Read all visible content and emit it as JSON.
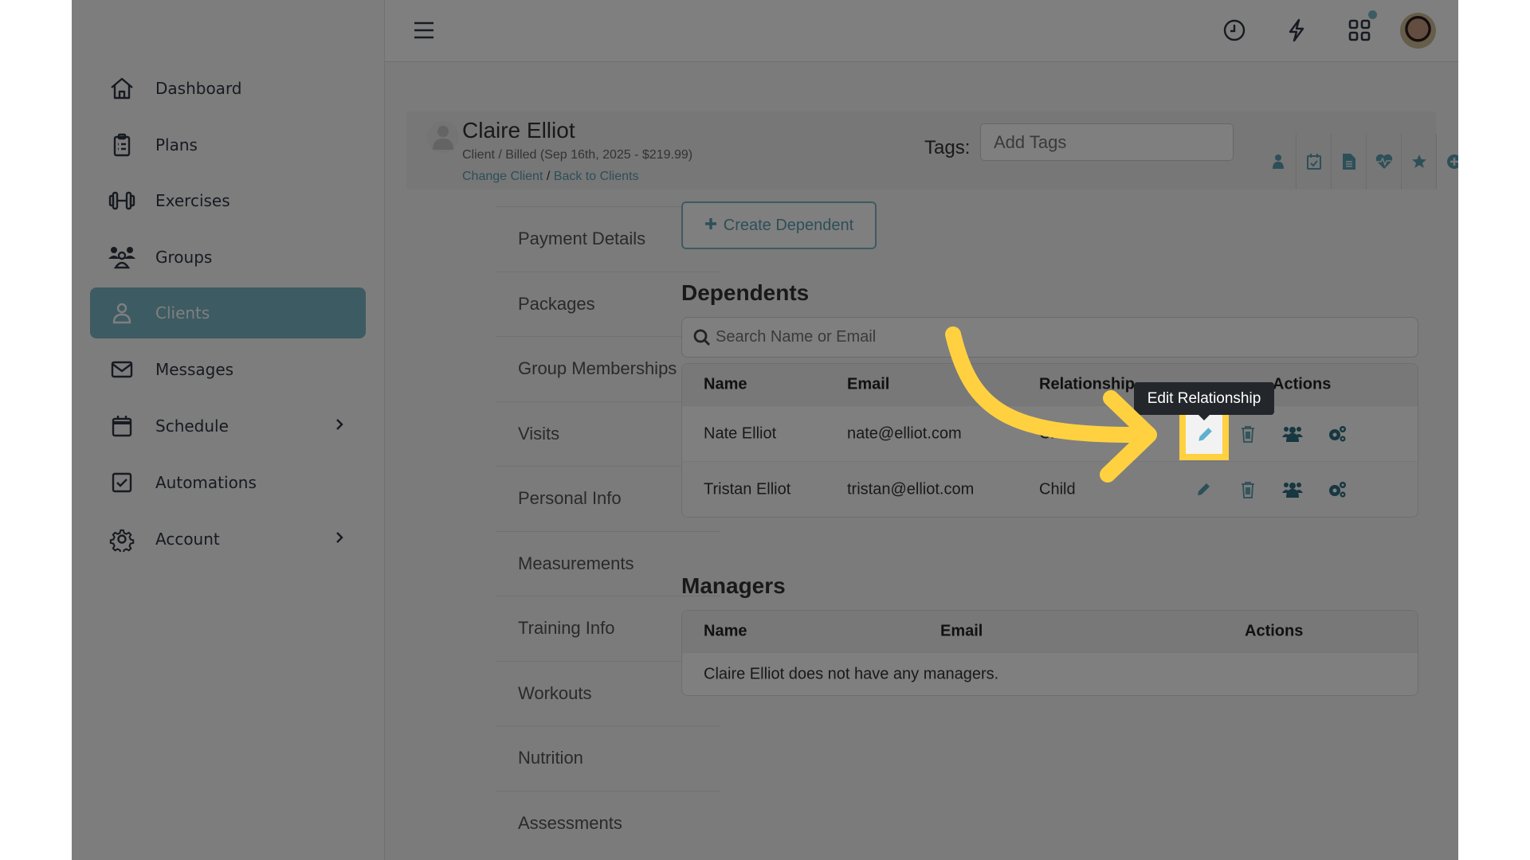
{
  "sidebar": {
    "items": [
      {
        "label": "Dashboard",
        "icon": "home-icon"
      },
      {
        "label": "Plans",
        "icon": "clipboard-icon"
      },
      {
        "label": "Exercises",
        "icon": "dumbbell-icon"
      },
      {
        "label": "Groups",
        "icon": "users-icon"
      },
      {
        "label": "Clients",
        "icon": "user-icon",
        "active": true
      },
      {
        "label": "Messages",
        "icon": "envelope-icon"
      },
      {
        "label": "Schedule",
        "icon": "calendar-icon",
        "has_submenu": true
      },
      {
        "label": "Automations",
        "icon": "checkbox-icon"
      },
      {
        "label": "Account",
        "icon": "gear-icon",
        "has_submenu": true
      }
    ]
  },
  "topbar": {
    "icons": [
      "menu-icon",
      "clock-icon",
      "lightning-icon",
      "grid-icon",
      "bell-icon",
      "avatar"
    ],
    "notification_dot": true
  },
  "client": {
    "name": "Claire Elliot",
    "subtitle": "Client / Billed (Sep 16th, 2025 - $219.99)",
    "change_client": "Change Client",
    "separator": "/",
    "back_to_clients": "Back to Clients",
    "tags_label": "Tags:",
    "tags_placeholder": "Add Tags",
    "header_icons": [
      "user-icon",
      "calendar-check-icon",
      "document-icon",
      "heartbeat-icon",
      "star-icon",
      "plus-circle-icon",
      "envelope-icon"
    ]
  },
  "subnav": {
    "items": [
      "Payment Details",
      "Packages",
      "Group Memberships",
      "Visits",
      "Personal Info",
      "Measurements",
      "Training Info",
      "Workouts",
      "Nutrition",
      "Assessments"
    ]
  },
  "dependents": {
    "create_button": "Create Dependent",
    "title": "Dependents",
    "search_placeholder": "Search Name or Email",
    "columns": [
      "Name",
      "Email",
      "Relationship",
      "Actions"
    ],
    "rows": [
      {
        "name": "Nate Elliot",
        "email": "nate@elliot.com",
        "relationship": "Child"
      },
      {
        "name": "Tristan Elliot",
        "email": "tristan@elliot.com",
        "relationship": "Child"
      }
    ],
    "action_icons": [
      "pencil-icon",
      "trash-icon",
      "users-icon",
      "gears-icon"
    ]
  },
  "managers": {
    "title": "Managers",
    "columns": [
      "Name",
      "Email",
      "Actions"
    ],
    "empty_message": "Claire Elliot does not have any managers."
  },
  "tooltip": {
    "text": "Edit Relationship"
  },
  "colors": {
    "accent": "#7ab6c4",
    "link": "#5b9fb0",
    "highlight": "#ffd140",
    "tooltip_bg": "#23262b"
  }
}
